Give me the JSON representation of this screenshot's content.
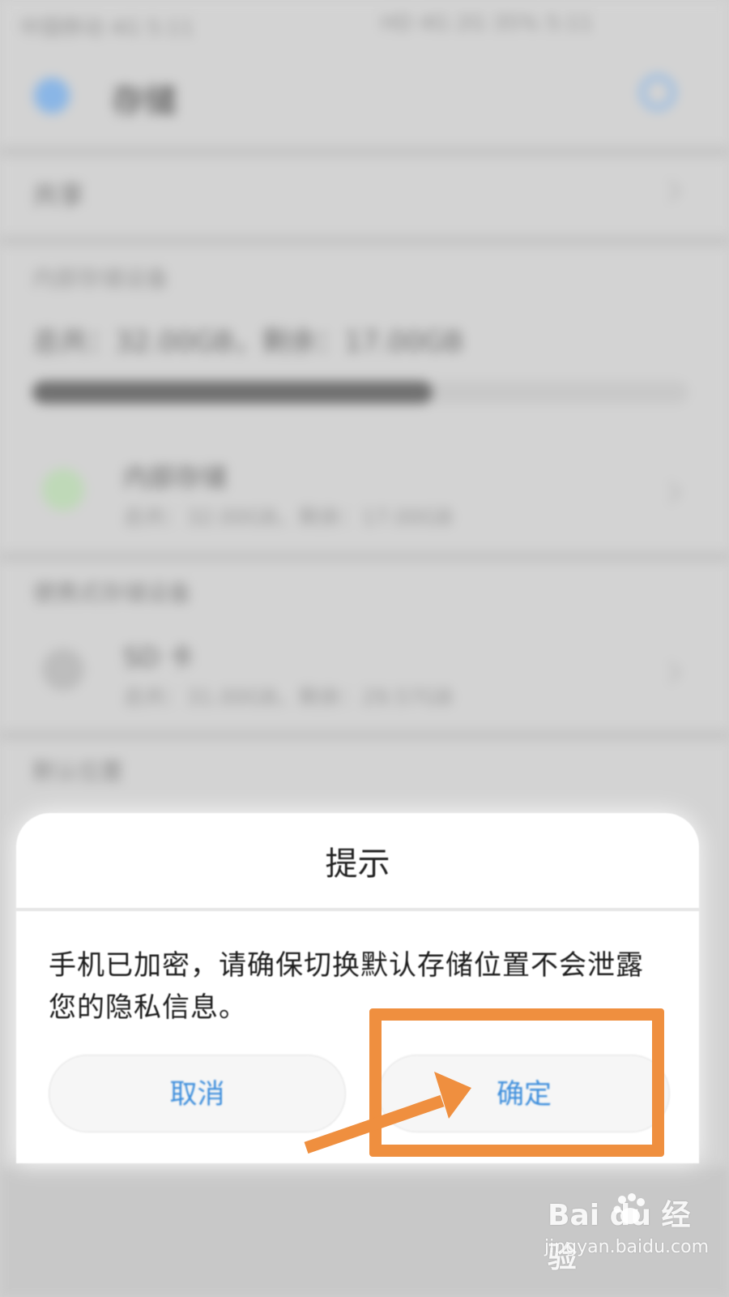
{
  "background": {
    "status_left": "中国移动 4G 5:11",
    "status_right": "HD 4G 2G 35% 5:11",
    "header_title": "存储",
    "row_restore": "共享",
    "section_internal": "内部存储设备",
    "internal_usage": "总共：32.00GB，剩余：17.00GB",
    "storage_used_fraction": 0.61,
    "internal_item_title": "内部存储",
    "internal_item_sub": "总共：32.00GB，剩余：17.00GB",
    "section_portable": "便携式存储设备",
    "sd_item_title": "SD 卡",
    "sd_item_sub": "总共：31.00GB，剩余：29.57GB",
    "section_default": "默认位置"
  },
  "dialog": {
    "title": "提示",
    "message": "手机已加密，请确保切换默认存储位置不会泄露您的隐私信息。",
    "cancel_label": "取消",
    "confirm_label": "确定"
  },
  "colors": {
    "accent": "#3f8fdc",
    "annotation": "#ef8f3f"
  },
  "watermark": {
    "logo": "Bai  du 经验",
    "url": "jingyan.baidu.com"
  }
}
